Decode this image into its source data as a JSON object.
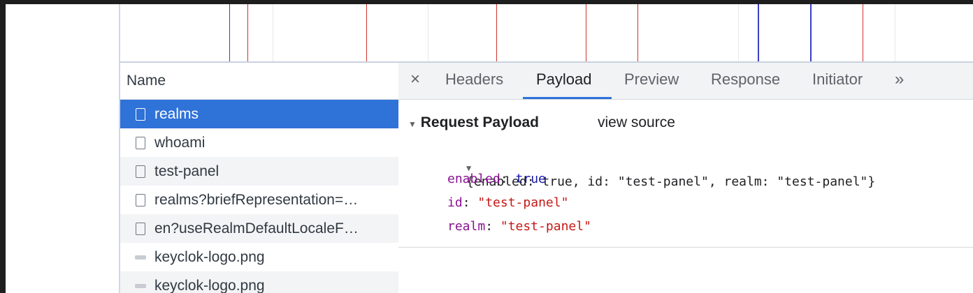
{
  "timeline": {
    "markers": [
      {
        "kind": "blue"
      },
      {
        "kind": "red"
      },
      {
        "kind": "grid"
      },
      {
        "kind": "red"
      },
      {
        "kind": "grid"
      },
      {
        "kind": "red"
      },
      {
        "kind": "red"
      },
      {
        "kind": "red"
      },
      {
        "kind": "grid"
      },
      {
        "kind": "blue"
      },
      {
        "kind": "blue"
      },
      {
        "kind": "red"
      },
      {
        "kind": "grid"
      }
    ]
  },
  "request_list": {
    "header": "Name",
    "rows": [
      {
        "name": "realms",
        "icon": "document-icon"
      },
      {
        "name": "whoami",
        "icon": "document-icon"
      },
      {
        "name": "test-panel",
        "icon": "document-icon"
      },
      {
        "name": "realms?briefRepresentation=…",
        "icon": "document-icon"
      },
      {
        "name": "en?useRealmDefaultLocaleF…",
        "icon": "document-icon"
      },
      {
        "name": "keyclok-logo.png",
        "icon": "image-icon"
      },
      {
        "name": "keyclok-logo.png",
        "icon": "image-icon"
      }
    ]
  },
  "details": {
    "close_glyph": "×",
    "tabs": [
      "Headers",
      "Payload",
      "Preview",
      "Response",
      "Initiator"
    ],
    "active_tab": "Payload",
    "more_glyph": "»",
    "section_title": "Request Payload",
    "view_source": "view source",
    "payload_summary": "{enabled: true, id: \"test-panel\", realm: \"test-panel\"}",
    "fields": [
      {
        "key": "enabled",
        "value": "true",
        "type": "bool"
      },
      {
        "key": "id",
        "value": "\"test-panel\"",
        "type": "string"
      },
      {
        "key": "realm",
        "value": "\"test-panel\"",
        "type": "string"
      }
    ]
  },
  "colors": {
    "selection": "#2f72d8",
    "key": "#881391",
    "string": "#c41a16",
    "bool": "#1a1aa6",
    "marker_blue": "#3b3ec6",
    "marker_red": "#d0342c"
  }
}
